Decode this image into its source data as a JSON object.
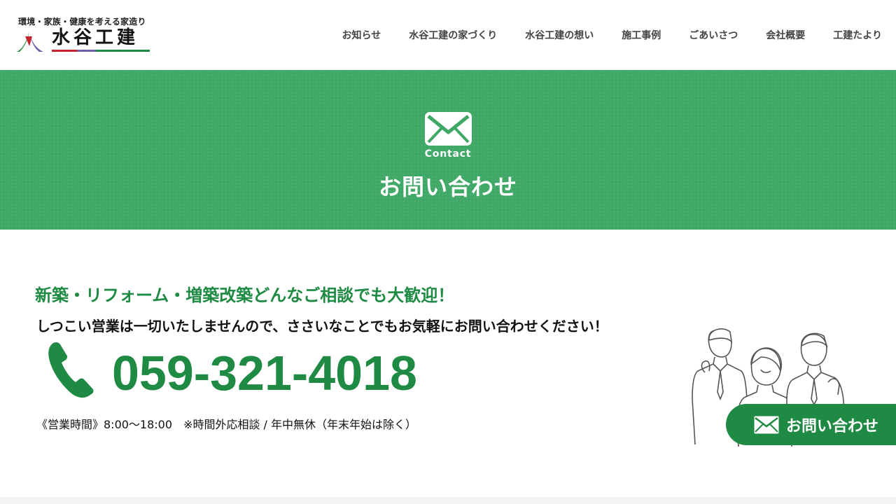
{
  "logo": {
    "tagline": "環境・家族・健康を考える家造り",
    "name": "水谷工建"
  },
  "nav": {
    "items": [
      {
        "label": "お知らせ"
      },
      {
        "label": "水谷工建の家づくり"
      },
      {
        "label": "水谷工建の想い"
      },
      {
        "label": "施工事例"
      },
      {
        "label": "ごあいさつ"
      },
      {
        "label": "会社概要"
      },
      {
        "label": "工建たより"
      }
    ]
  },
  "hero": {
    "icon": "mail-icon",
    "en_label": "Contact",
    "title": "お問い合わせ"
  },
  "contact": {
    "lead": "新築・リフォーム・増築改築どんなご相談でも大歓迎！",
    "sub": "しつこい営業は一切いたしませんので、ささいなことでもお気軽にお問い合わせください！",
    "phone_icon": "phone-icon",
    "phone": "059-321-4018",
    "hours": "《営業時間》8:00〜18:00　※時間外応相談 / 年中無休（年末年始は除く）"
  },
  "float_button": {
    "icon": "mail-icon",
    "label": "お問い合わせ"
  },
  "colors": {
    "brand_green": "#1f8a43",
    "hero_green": "#3fa866",
    "logo_red": "#c4232e",
    "logo_purple": "#6f5fa8"
  }
}
